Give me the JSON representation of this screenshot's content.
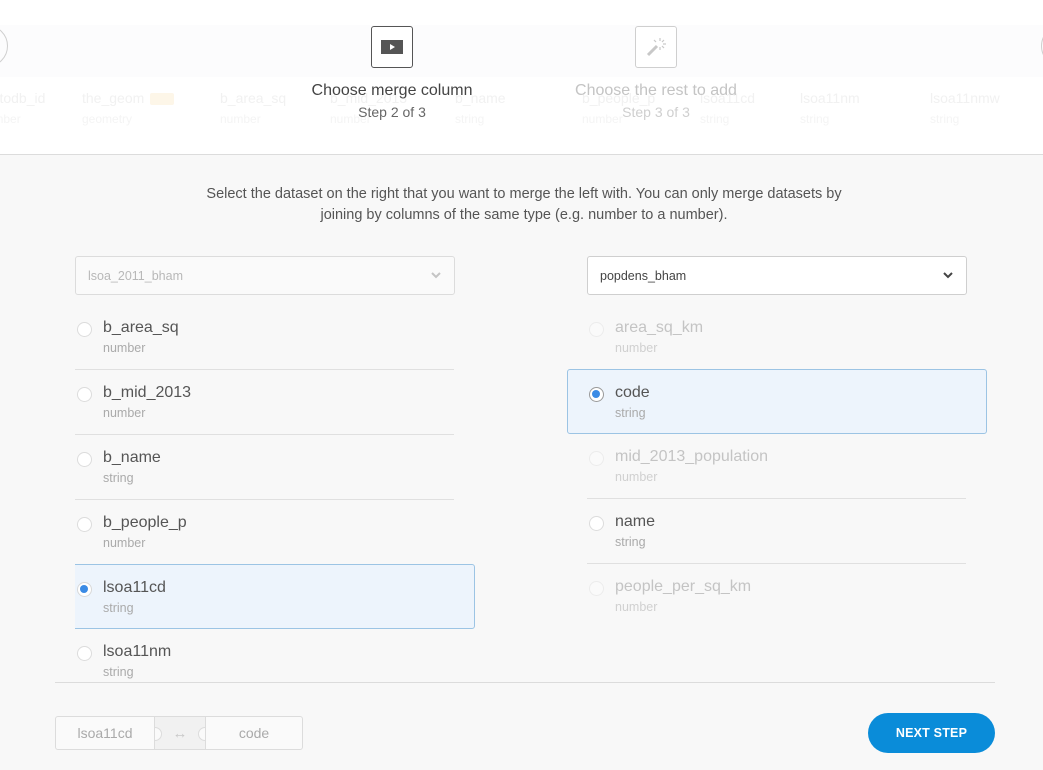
{
  "stepper": {
    "steps": [
      {
        "label": "Choose merge column",
        "sub": "Step 2 of 3",
        "icon": "play-icon",
        "state": "active"
      },
      {
        "label": "Choose the rest to add",
        "sub": "Step 3 of 3",
        "icon": "magic-wand-icon",
        "state": "inactive"
      }
    ],
    "background_columns": [
      {
        "name": "cartodb_id",
        "type": "number"
      },
      {
        "name": "the_geom",
        "type": "geometry"
      },
      {
        "name": "b_area_sq",
        "type": "number"
      },
      {
        "name": "b_mid_2013",
        "type": "number"
      },
      {
        "name": "b_name",
        "type": "string"
      },
      {
        "name": "b_people_p",
        "type": "number"
      },
      {
        "name": "lsoa11cd",
        "type": "string"
      },
      {
        "name": "lsoa11nm",
        "type": "string"
      },
      {
        "name": "lsoa11nmw",
        "type": "string"
      }
    ]
  },
  "instructions": "Select the dataset on the right that you want to merge the left with. You can only merge datasets by joining by columns of the same type (e.g. number to a number).",
  "left": {
    "dataset": "lsoa_2011_bham",
    "columns": [
      {
        "name": "b_area_sq",
        "type": "number",
        "state": "normal"
      },
      {
        "name": "b_mid_2013",
        "type": "number",
        "state": "normal"
      },
      {
        "name": "b_name",
        "type": "string",
        "state": "normal"
      },
      {
        "name": "b_people_p",
        "type": "number",
        "state": "normal"
      },
      {
        "name": "lsoa11cd",
        "type": "string",
        "state": "selected"
      },
      {
        "name": "lsoa11nm",
        "type": "string",
        "state": "normal"
      }
    ]
  },
  "right": {
    "dataset": "popdens_bham",
    "columns": [
      {
        "name": "area_sq_km",
        "type": "number",
        "state": "disabled"
      },
      {
        "name": "code",
        "type": "string",
        "state": "selected"
      },
      {
        "name": "mid_2013_population",
        "type": "number",
        "state": "disabled"
      },
      {
        "name": "name",
        "type": "string",
        "state": "normal"
      },
      {
        "name": "people_per_sq_km",
        "type": "number",
        "state": "disabled"
      }
    ]
  },
  "footer": {
    "merge_left": "lsoa11cd",
    "merge_symbol": "↔",
    "merge_right": "code",
    "next_label": "NEXT STEP"
  },
  "colors": {
    "accent": "#0a8cd9",
    "radio_selected": "#3b8be5",
    "selected_bg": "#edf4fc",
    "selected_border": "#9cc4e4"
  }
}
